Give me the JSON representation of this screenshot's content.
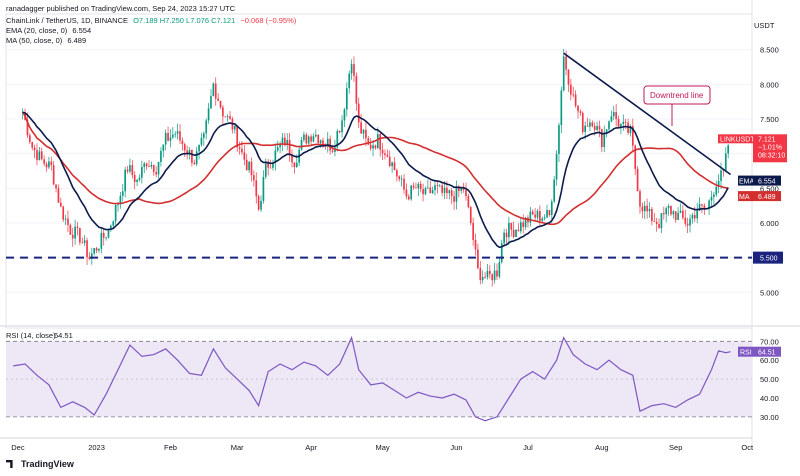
{
  "header": {
    "publisher": "ranadagger published on TradingView.com, Sep 24, 2023 15:27 UTC",
    "symbol": "ChainLink / TetherUS, 1D, BINANCE",
    "ohlc": "O7.189 H7.250 L7.076 C7.121",
    "change": "−0.068 (−0.95%)",
    "ema_label": "EMA (20, close, 0)",
    "ema_value": "6.554",
    "ma_label": "MA (50, close, 0)",
    "ma_value": "6.489",
    "currency": "USDT"
  },
  "footer": {
    "brand": "TradingView"
  },
  "colors": {
    "up": "#089981",
    "down": "#f23645",
    "ema": "#0d1b4c",
    "ma": "#d32f2f",
    "support": "#1a237e",
    "rsi": "#7e57c2",
    "rsi_band": "#ede7f6",
    "trend": "#0d1b4c",
    "annotation": "#c2185b"
  },
  "chart_data": [
    {
      "type": "candlestick",
      "title": "ChainLink / TetherUS, 1D, BINANCE",
      "ylim": [
        4.6,
        8.9
      ],
      "y_ticks": [
        "8.500",
        "8.000",
        "7.500",
        "7.000",
        "6.500",
        "6.000",
        "5.500",
        "5.000"
      ],
      "x_ticks": [
        "Dec",
        "2023",
        "Feb",
        "Mar",
        "Apr",
        "May",
        "Jun",
        "Jul",
        "Aug",
        "Sep",
        "Oct"
      ],
      "candle_anchors": [
        [
          "2022-12-01",
          7.6
        ],
        [
          "2022-12-05",
          7.1
        ],
        [
          "2022-12-09",
          6.9
        ],
        [
          "2022-12-13",
          6.8
        ],
        [
          "2022-12-17",
          6.2
        ],
        [
          "2022-12-21",
          5.9
        ],
        [
          "2022-12-25",
          5.8
        ],
        [
          "2022-12-29",
          5.5
        ],
        [
          "2023-01-02",
          5.7
        ],
        [
          "2023-01-06",
          5.9
        ],
        [
          "2023-01-10",
          6.3
        ],
        [
          "2023-01-14",
          6.8
        ],
        [
          "2023-01-18",
          6.6
        ],
        [
          "2023-01-22",
          6.9
        ],
        [
          "2023-01-26",
          6.8
        ],
        [
          "2023-01-30",
          7.2
        ],
        [
          "2023-02-03",
          7.3
        ],
        [
          "2023-02-07",
          7.1
        ],
        [
          "2023-02-11",
          6.9
        ],
        [
          "2023-02-15",
          7.2
        ],
        [
          "2023-02-19",
          8.0
        ],
        [
          "2023-02-23",
          7.6
        ],
        [
          "2023-02-27",
          7.4
        ],
        [
          "2023-03-03",
          7.0
        ],
        [
          "2023-03-07",
          6.7
        ],
        [
          "2023-03-10",
          6.2
        ],
        [
          "2023-03-13",
          6.8
        ],
        [
          "2023-03-17",
          7.0
        ],
        [
          "2023-03-21",
          7.2
        ],
        [
          "2023-03-25",
          6.9
        ],
        [
          "2023-03-29",
          7.2
        ],
        [
          "2023-04-02",
          7.3
        ],
        [
          "2023-04-06",
          7.2
        ],
        [
          "2023-04-10",
          7.1
        ],
        [
          "2023-04-14",
          7.5
        ],
        [
          "2023-04-18",
          8.4
        ],
        [
          "2023-04-21",
          7.4
        ],
        [
          "2023-04-25",
          7.1
        ],
        [
          "2023-04-29",
          7.2
        ],
        [
          "2023-05-03",
          7.0
        ],
        [
          "2023-05-07",
          6.7
        ],
        [
          "2023-05-11",
          6.4
        ],
        [
          "2023-05-15",
          6.5
        ],
        [
          "2023-05-19",
          6.4
        ],
        [
          "2023-05-23",
          6.5
        ],
        [
          "2023-05-27",
          6.4
        ],
        [
          "2023-05-31",
          6.4
        ],
        [
          "2023-06-04",
          6.5
        ],
        [
          "2023-06-07",
          6.0
        ],
        [
          "2023-06-10",
          5.3
        ],
        [
          "2023-06-14",
          5.2
        ],
        [
          "2023-06-18",
          5.3
        ],
        [
          "2023-06-21",
          5.9
        ],
        [
          "2023-06-25",
          5.9
        ],
        [
          "2023-06-29",
          6.0
        ],
        [
          "2023-07-03",
          6.1
        ],
        [
          "2023-07-07",
          6.1
        ],
        [
          "2023-07-10",
          6.1
        ],
        [
          "2023-07-13",
          7.0
        ],
        [
          "2023-07-16",
          8.4
        ],
        [
          "2023-07-20",
          7.8
        ],
        [
          "2023-07-24",
          7.4
        ],
        [
          "2023-07-28",
          7.5
        ],
        [
          "2023-08-01",
          7.2
        ],
        [
          "2023-08-05",
          7.6
        ],
        [
          "2023-08-09",
          7.4
        ],
        [
          "2023-08-13",
          7.3
        ],
        [
          "2023-08-17",
          6.3
        ],
        [
          "2023-08-21",
          6.1
        ],
        [
          "2023-08-25",
          6.0
        ],
        [
          "2023-08-29",
          6.2
        ],
        [
          "2023-09-02",
          6.1
        ],
        [
          "2023-09-06",
          6.0
        ],
        [
          "2023-09-10",
          6.2
        ],
        [
          "2023-09-14",
          6.2
        ],
        [
          "2023-09-18",
          6.6
        ],
        [
          "2023-09-21",
          6.7
        ],
        [
          "2023-09-23",
          7.12
        ]
      ],
      "ema_20_last": 6.554,
      "ma_50_last": 6.489,
      "last_close": 7.121,
      "last_change_pct": -1.0,
      "support_level": 5.5,
      "support_label": "5.500",
      "downtrend_line": {
        "from": [
          "2023-07-16",
          8.45
        ],
        "to": [
          "2023-09-24",
          6.7
        ]
      },
      "annotation": "Downtrend line",
      "badges": {
        "price": {
          "title": "LINKUSDT",
          "value": "7.121",
          "change": "−1.01%",
          "timer": "08:32:10"
        },
        "ema": {
          "label": "EMA",
          "value": "6.554"
        },
        "ma": {
          "label": "MA",
          "value": "6.489"
        }
      }
    },
    {
      "type": "line",
      "title": "RSI (14, close)",
      "value_label": "64.51",
      "ylim": [
        22,
        76
      ],
      "y_ticks": [
        "70.00",
        "60.00",
        "50.00",
        "40.00",
        "30.00"
      ],
      "band": [
        30,
        70
      ],
      "series": [
        {
          "name": "RSI (14, close)",
          "values": [
            [
              "2022-11-27",
              57
            ],
            [
              "2022-12-02",
              58
            ],
            [
              "2022-12-07",
              52
            ],
            [
              "2022-12-12",
              47
            ],
            [
              "2022-12-17",
              35
            ],
            [
              "2022-12-22",
              38
            ],
            [
              "2022-12-27",
              35
            ],
            [
              "2022-12-31",
              31
            ],
            [
              "2023-01-05",
              42
            ],
            [
              "2023-01-10",
              55
            ],
            [
              "2023-01-15",
              68
            ],
            [
              "2023-01-20",
              62
            ],
            [
              "2023-01-25",
              63
            ],
            [
              "2023-01-30",
              66
            ],
            [
              "2023-02-04",
              60
            ],
            [
              "2023-02-09",
              53
            ],
            [
              "2023-02-14",
              52
            ],
            [
              "2023-02-19",
              66
            ],
            [
              "2023-02-24",
              56
            ],
            [
              "2023-03-01",
              50
            ],
            [
              "2023-03-06",
              44
            ],
            [
              "2023-03-10",
              36
            ],
            [
              "2023-03-14",
              54
            ],
            [
              "2023-03-19",
              58
            ],
            [
              "2023-03-24",
              55
            ],
            [
              "2023-03-29",
              59
            ],
            [
              "2023-04-03",
              57
            ],
            [
              "2023-04-08",
              52
            ],
            [
              "2023-04-13",
              58
            ],
            [
              "2023-04-18",
              72
            ],
            [
              "2023-04-21",
              55
            ],
            [
              "2023-04-26",
              47
            ],
            [
              "2023-05-01",
              48
            ],
            [
              "2023-05-06",
              44
            ],
            [
              "2023-05-11",
              40
            ],
            [
              "2023-05-16",
              43
            ],
            [
              "2023-05-21",
              41
            ],
            [
              "2023-05-26",
              40
            ],
            [
              "2023-05-31",
              42
            ],
            [
              "2023-06-05",
              39
            ],
            [
              "2023-06-09",
              30
            ],
            [
              "2023-06-13",
              28
            ],
            [
              "2023-06-18",
              30
            ],
            [
              "2023-06-23",
              40
            ],
            [
              "2023-06-28",
              50
            ],
            [
              "2023-07-03",
              54
            ],
            [
              "2023-07-08",
              50
            ],
            [
              "2023-07-13",
              60
            ],
            [
              "2023-07-16",
              72
            ],
            [
              "2023-07-20",
              63
            ],
            [
              "2023-07-25",
              58
            ],
            [
              "2023-07-30",
              55
            ],
            [
              "2023-08-04",
              60
            ],
            [
              "2023-08-09",
              55
            ],
            [
              "2023-08-14",
              52
            ],
            [
              "2023-08-17",
              33
            ],
            [
              "2023-08-22",
              36
            ],
            [
              "2023-08-27",
              37
            ],
            [
              "2023-09-01",
              35
            ],
            [
              "2023-09-06",
              39
            ],
            [
              "2023-09-11",
              42
            ],
            [
              "2023-09-16",
              55
            ],
            [
              "2023-09-19",
              65
            ],
            [
              "2023-09-22",
              64
            ],
            [
              "2023-09-24",
              64.51
            ]
          ]
        }
      ]
    }
  ]
}
